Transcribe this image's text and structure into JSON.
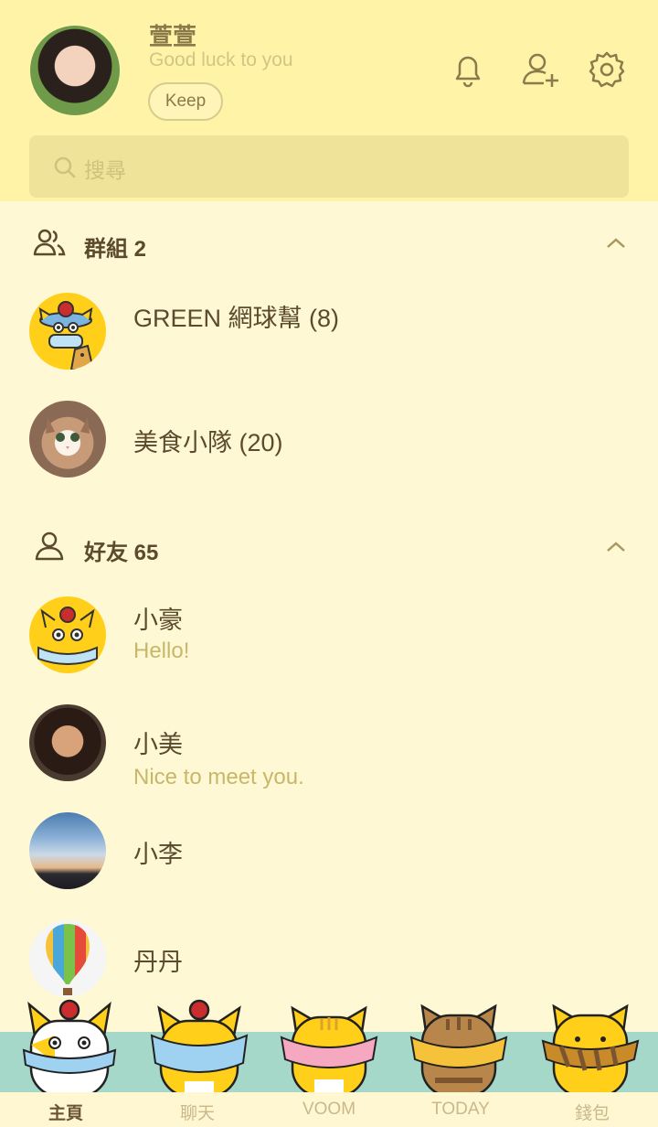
{
  "profile": {
    "name": "萱萱",
    "status": "Good luck to you",
    "keep_label": "Keep"
  },
  "header_icons": [
    "bell-icon",
    "add-friend-icon",
    "gear-icon"
  ],
  "search": {
    "placeholder": "搜尋"
  },
  "groups_section": {
    "title": "群組 2",
    "items": [
      {
        "name": "GREEN 網球幫 (8)",
        "avatar": "cat-mascot-avatar"
      },
      {
        "name": "美食小隊 (20)",
        "avatar": "fluffy-cat-photo"
      }
    ]
  },
  "friends_section": {
    "title": "好友 65",
    "items": [
      {
        "name": "小豪",
        "message": "Hello!",
        "avatar": "cat-mascot-avatar"
      },
      {
        "name": "小美",
        "message": "Nice to meet you.",
        "avatar": "woman-photo"
      },
      {
        "name": "小李",
        "message": "",
        "avatar": "sky-photo"
      },
      {
        "name": "丹丹",
        "message": "",
        "avatar": "hot-air-balloon-photo"
      }
    ]
  },
  "tabs": [
    {
      "label": "主頁",
      "active": true
    },
    {
      "label": "聊天",
      "active": false
    },
    {
      "label": "VOOM",
      "active": false
    },
    {
      "label": "TODAY",
      "active": false
    },
    {
      "label": "錢包",
      "active": false
    }
  ],
  "colors": {
    "header_bg": "#fff3a8",
    "body_bg": "#fef9d4",
    "search_bg": "#efe399",
    "accent_text": "#5b4a2c",
    "muted_text": "#c8b66a",
    "bottom_band": "#a6d8c9"
  }
}
